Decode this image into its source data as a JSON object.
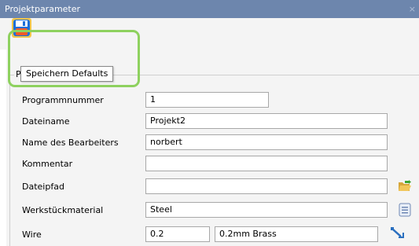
{
  "window": {
    "title": "Projektparameter",
    "close_glyph": "×"
  },
  "toolbar": {
    "save_icon": "save-defaults-icon",
    "tooltip": "Speichern Defaults"
  },
  "group": {
    "title": "P"
  },
  "fields": {
    "program_number": {
      "label": "Programmnummer",
      "value": "1"
    },
    "filename": {
      "label": "Dateiname",
      "value": "Projekt2"
    },
    "operator": {
      "label": "Name des Bearbeiters",
      "value": "norbert"
    },
    "comment": {
      "label": "Kommentar",
      "value": ""
    },
    "filepath": {
      "label": "Dateipfad",
      "value": "",
      "icon": "open-folder-icon"
    },
    "material": {
      "label": "Werkstückmaterial",
      "value": "Steel",
      "icon": "list-icon"
    },
    "wire": {
      "label": "Wire",
      "value": "0.2",
      "description": "0.2mm Brass",
      "icon": "wire-tool-icon"
    }
  }
}
